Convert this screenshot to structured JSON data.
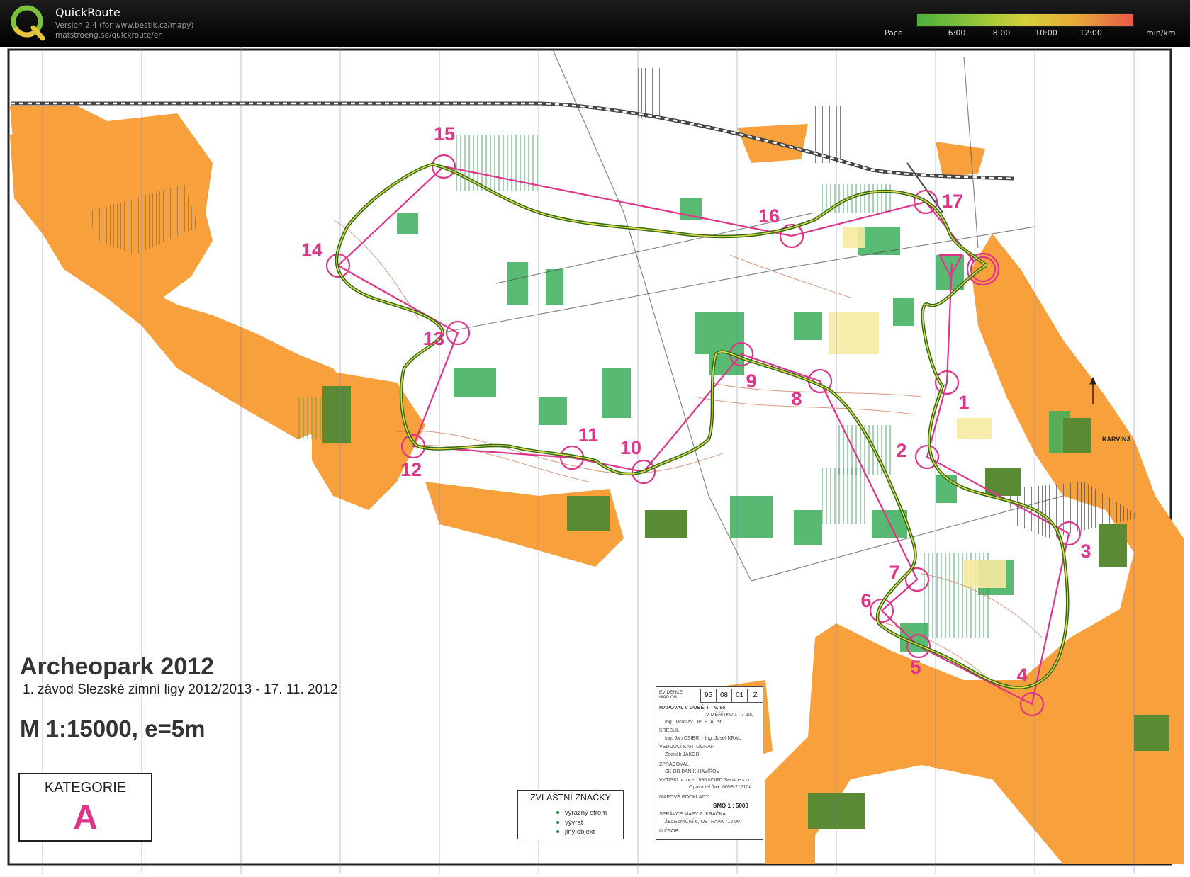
{
  "app": {
    "name": "QuickRoute",
    "version_line": "Version 2.4  (for www.bestik.cz/mapy)",
    "url_line": "matstroeng.se/quickroute/en"
  },
  "pace_scale": {
    "label": "Pace",
    "ticks": [
      "6:00",
      "8:00",
      "10:00",
      "12:00"
    ],
    "unit": "min/km",
    "colors": [
      "#4caf3c",
      "#8cc43a",
      "#d6d03a",
      "#e8a53a",
      "#e4584a"
    ]
  },
  "map": {
    "title": "Archeopark 2012",
    "subtitle": "1. závod Slezské zimní ligy 2012/2013 - 17. 11. 2012",
    "scale": "M 1:15000, e=5m",
    "category_label": "KATEGORIE",
    "category": "A",
    "direction_label": "KARVINÁ",
    "course_color": "#e0338a",
    "route_color": "#4a8a1e"
  },
  "controls": [
    {
      "number": "1"
    },
    {
      "number": "2"
    },
    {
      "number": "3"
    },
    {
      "number": "4"
    },
    {
      "number": "5"
    },
    {
      "number": "6"
    },
    {
      "number": "7"
    },
    {
      "number": "8"
    },
    {
      "number": "9"
    },
    {
      "number": "10"
    },
    {
      "number": "11"
    },
    {
      "number": "12"
    },
    {
      "number": "13"
    },
    {
      "number": "14"
    },
    {
      "number": "15"
    },
    {
      "number": "16"
    },
    {
      "number": "17"
    }
  ],
  "legend": {
    "title": "ZVLÁŠTNÍ ZNAČKY",
    "items": [
      "výrazný strom",
      "vývrat",
      "jiný objekt"
    ]
  },
  "info_box": {
    "evidence_label": "EVIDENCE MAP OB",
    "codes": [
      "95",
      "08",
      "01",
      "Z"
    ],
    "mapped_label": "MAPOVAL   V DOBĚ:   I. - V. 95",
    "scale_note": "V MĚŘÍTKU   1 : 7 500",
    "mapper": "Ing. Jaroslav OPLETAL st.",
    "drawn_label": "KRESLIL",
    "drawn_by": "Ing. Jan CSIBRI · Ing. Josef KRÁL",
    "cartographer_label": "VEDOUCÍ KARTOGRAF",
    "cartographer": "Zdeněk JAKOB",
    "processed_label": "ZPRACOVAL",
    "processed_by": "SK OB BANÍK HAVÍŘOV",
    "printed": "VYTISKL v roce 1995   NORD Service s.r.o.",
    "printed_addr": "Opava tel./fax. 0653-212104",
    "base_label": "MAPOVÉ PODKLADY",
    "base": "SMO 1 : 5000",
    "admin_label": "SPRÁVCE MAPY     Z. KRAČKA",
    "admin_addr": "ŽELEZNIČNÍ 6, OSTRAVA 712 00",
    "copyright": "© ČSOB"
  }
}
